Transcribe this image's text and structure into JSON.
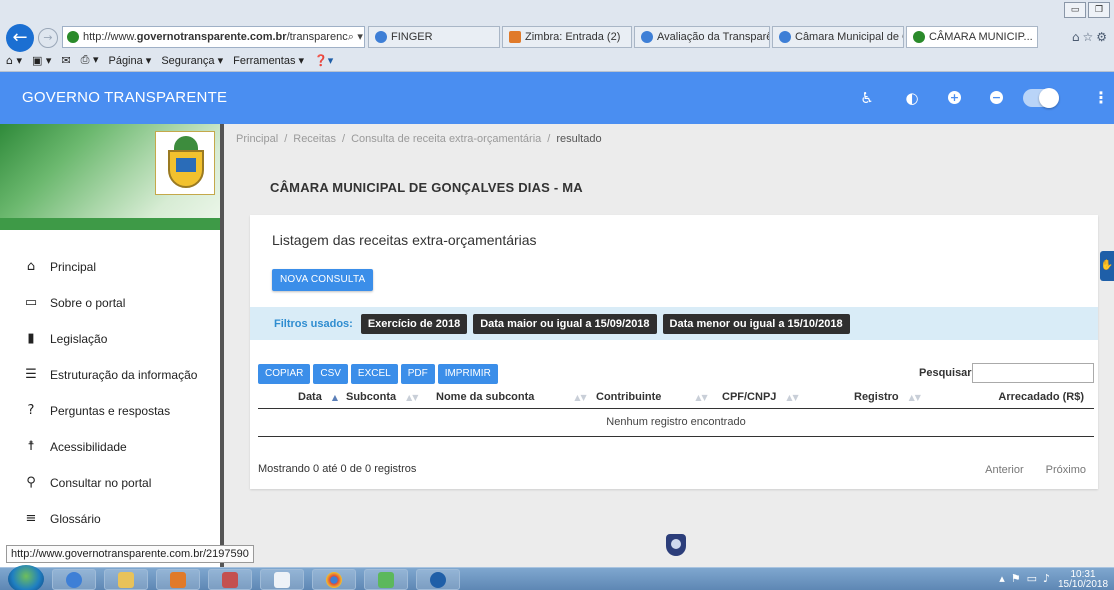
{
  "browser": {
    "url_prefix": "http://www.",
    "url_domain": "governotransparente.com.br",
    "url_path": "/transparenc",
    "addr_tools": "⌕ ▾ C",
    "tabs": [
      {
        "label": "FINGER"
      },
      {
        "label": "Zimbra: Entrada (2)"
      },
      {
        "label": "Avaliação da Transparê..."
      },
      {
        "label": "Câmara Municipal de G..."
      },
      {
        "label": "CÂMARA MUNICIP...",
        "close": "×"
      }
    ],
    "command_bar": [
      "Página ▾",
      "Segurança ▾",
      "Ferramentas ▾"
    ],
    "status_url": "http://www.governotransparente.com.br/2197590"
  },
  "header": {
    "brand": "GOVERNO TRANSPARENTE"
  },
  "sidebar": {
    "items": [
      {
        "label": "Principal"
      },
      {
        "label": "Sobre o portal"
      },
      {
        "label": "Legislação"
      },
      {
        "label": "Estruturação da informação"
      },
      {
        "label": "Perguntas e respostas"
      },
      {
        "label": "Acessibilidade"
      },
      {
        "label": "Consultar no portal"
      },
      {
        "label": "Glossário"
      }
    ]
  },
  "breadcrumb": {
    "items": [
      "Principal",
      "Receitas",
      "Consulta de receita extra-orçamentária"
    ],
    "current": "resultado",
    "separator": "/"
  },
  "page": {
    "title": "CÂMARA MUNICIPAL DE GONÇALVES DIAS - MA"
  },
  "card": {
    "title": "Listagem das receitas extra-orçamentárias",
    "new_query_button": "NOVA CONSULTA",
    "filters_label": "Filtros usados:",
    "filters": [
      "Exercício de 2018",
      "Data maior ou igual a 15/09/2018",
      "Data menor ou igual a 15/10/2018"
    ],
    "export_buttons": [
      "COPIAR",
      "CSV",
      "EXCEL",
      "PDF",
      "IMPRIMIR"
    ],
    "search_label": "Pesquisar",
    "search_value": "",
    "columns": [
      "Data",
      "Subconta",
      "Nome da subconta",
      "Contribuinte",
      "CPF/CNPJ",
      "Registro",
      "Arrecadado (R$)"
    ],
    "empty_message": "Nenhum registro encontrado",
    "info": "Mostrando 0 até 0 de 0 registros",
    "prev": "Anterior",
    "next": "Próximo"
  },
  "taskbar": {
    "clock_time": "10:31",
    "clock_date": "15/10/2018"
  }
}
